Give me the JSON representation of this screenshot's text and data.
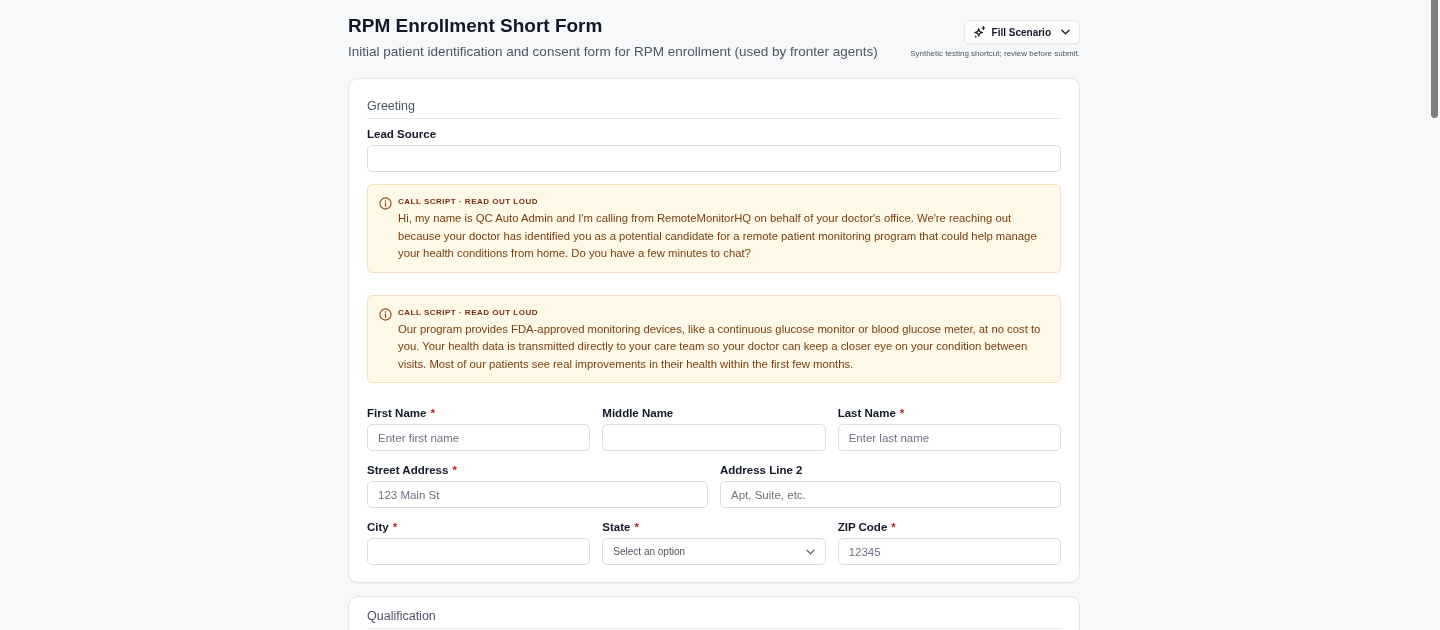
{
  "header": {
    "title": "RPM Enrollment Short Form",
    "subtitle": "Initial patient identification and consent form for RPM enrollment (used by fronter agents)",
    "fill_button": {
      "label": "Fill Scenario"
    },
    "fill_hint": "Synthetic testing shortcut; review before submit."
  },
  "sections": [
    {
      "title": "Greeting",
      "items": [
        {
          "kind": "row",
          "fields": [
            {
              "kind": "text",
              "label": "Lead Source"
            }
          ]
        },
        {
          "kind": "script",
          "label": "CALL SCRIPT · READ OUT LOUD",
          "text": "Hi, my name is QC Auto Admin and I'm calling from RemoteMonitorHQ on behalf of your doctor's office. We're reaching out because your doctor has identified you as a potential candidate for a remote patient monitoring program that could help manage your health conditions from home. Do you have a few minutes to chat?"
        },
        {
          "kind": "script",
          "label": "CALL SCRIPT · READ OUT LOUD",
          "text": "Our program provides FDA-approved monitoring devices, like a continuous glucose monitor or blood glucose meter, at no cost to you. Your health data is transmitted directly to your care team so your doctor can keep a closer eye on your condition between visits. Most of our patients see real improvements in their health within the first few months."
        },
        {
          "kind": "row",
          "fields": [
            {
              "kind": "text",
              "label": "First Name",
              "required_mark": "*",
              "placeholder": "Enter first name"
            },
            {
              "kind": "text",
              "label": "Middle Name"
            },
            {
              "kind": "text",
              "label": "Last Name",
              "required_mark": "*",
              "placeholder": "Enter last name"
            }
          ]
        },
        {
          "kind": "row",
          "fields": [
            {
              "kind": "text",
              "label": "Street Address",
              "required_mark": "*",
              "placeholder": "123 Main St"
            },
            {
              "kind": "text",
              "label": "Address Line 2",
              "placeholder": "Apt, Suite, etc."
            }
          ]
        },
        {
          "kind": "row",
          "fields": [
            {
              "kind": "text",
              "label": "City",
              "required_mark": "*"
            },
            {
              "kind": "select",
              "label": "State",
              "required_mark": "*",
              "placeholder": "Select an option"
            },
            {
              "kind": "text",
              "label": "ZIP Code",
              "required_mark": "*",
              "placeholder": "12345"
            }
          ]
        }
      ]
    },
    {
      "title": "Qualification"
    }
  ]
}
